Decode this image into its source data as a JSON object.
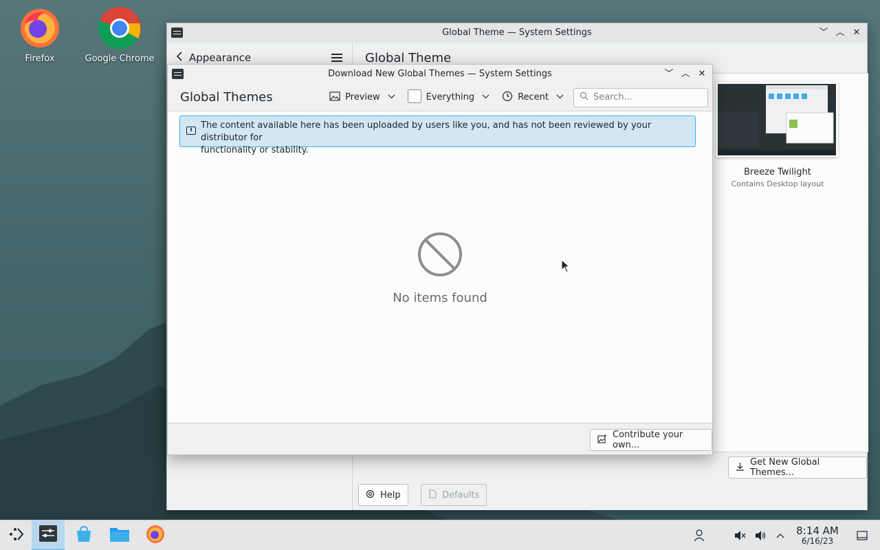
{
  "desktop": {
    "icons": [
      {
        "label": "Firefox",
        "icon": "firefox-icon"
      },
      {
        "label": "Google Chrome",
        "icon": "chrome-icon"
      }
    ]
  },
  "main_window": {
    "title": "Global Theme — System Settings",
    "sidebar": {
      "back_label": "Appearance",
      "menu_icon": "hamburger-menu-icon"
    },
    "page_title": "Global Theme",
    "themes": [
      {
        "name": "Breeze Twilight",
        "subtitle": "Contains Desktop layout"
      }
    ],
    "get_new_button": "Get New Global Themes...",
    "help_button": "Help",
    "defaults_button": "Defaults"
  },
  "dialog": {
    "title": "Download New Global Themes — System Settings",
    "heading": "Global Themes",
    "toolbar": {
      "preview_label": "Preview",
      "filter_label": "Everything",
      "sort_label": "Recent",
      "search_placeholder": "Search..."
    },
    "info_message_line1": "The content available here has been uploaded by users like you, and has not been reviewed by your distributor for",
    "info_message_line2": "functionality or stability.",
    "empty_message": "No items found",
    "contribute_button": "Contribute your own..."
  },
  "taskbar": {
    "time": "8:14 AM",
    "date": "6/16/23"
  },
  "colors": {
    "accent": "#3daee9",
    "info_background": "#d2e7f4",
    "window_background": "#eff0f1",
    "view_background": "#fcfcfc"
  }
}
